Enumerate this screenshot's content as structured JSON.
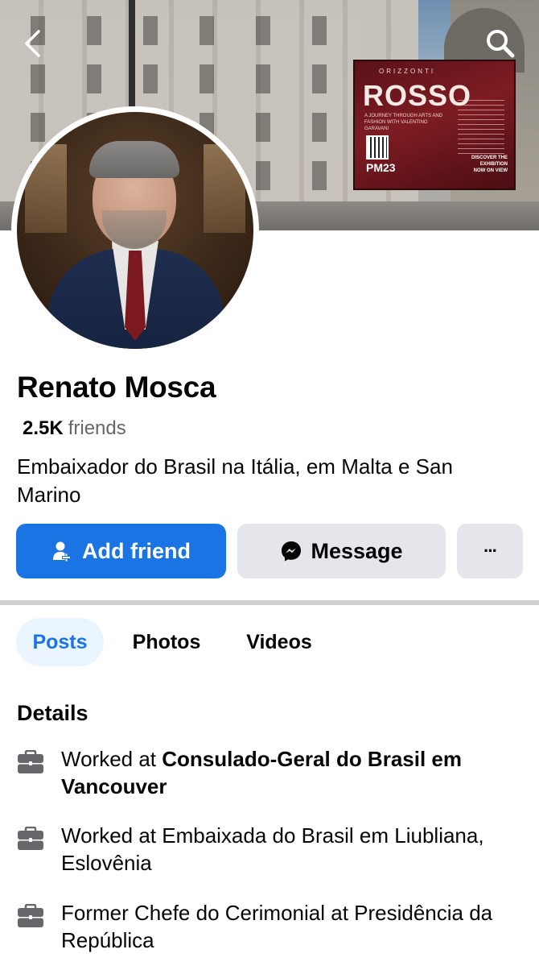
{
  "cover": {
    "billboard": {
      "kicker": "ORIZZONTI",
      "title": "ROSSO",
      "subtitle": "A JOURNEY THROUGH ARTS AND FASHION WITH VALENTINO GARAVANI",
      "brand": "PM23",
      "cta_line1": "DISCOVER THE EXHIBITION",
      "cta_line2": "NOW ON VIEW"
    }
  },
  "profile": {
    "name": "Renato Mosca",
    "friends_count": "2.5K",
    "friends_label": "friends",
    "bio": "Embaixador do Brasil na Itália, em Malta e San Marino"
  },
  "actions": {
    "add_friend": "Add friend",
    "message": "Message",
    "more": "···"
  },
  "tabs": [
    {
      "label": "Posts",
      "active": true
    },
    {
      "label": "Photos",
      "active": false
    },
    {
      "label": "Videos",
      "active": false
    }
  ],
  "details": {
    "heading": "Details",
    "items": [
      {
        "prefix": "Worked at ",
        "bold": "Consulado-Geral do Brasil em Vancouver",
        "rest": ""
      },
      {
        "prefix": "Worked at Embaixada do Brasil em Liubliana,  Eslovênia",
        "bold": "",
        "rest": ""
      },
      {
        "prefix": "Former Chefe do Cerimonial at Presidência da República",
        "bold": "",
        "rest": ""
      }
    ]
  },
  "icons": {
    "back": "chevron-left-icon",
    "search": "search-icon",
    "add_friend": "add-person-icon",
    "message": "messenger-icon",
    "work": "briefcase-icon"
  },
  "colors": {
    "primary": "#1b74e4",
    "secondary_button": "#e4e6eb",
    "active_tab_bg": "#ebf5ff",
    "muted_text": "#65676b",
    "divider": "#ced0d4"
  }
}
